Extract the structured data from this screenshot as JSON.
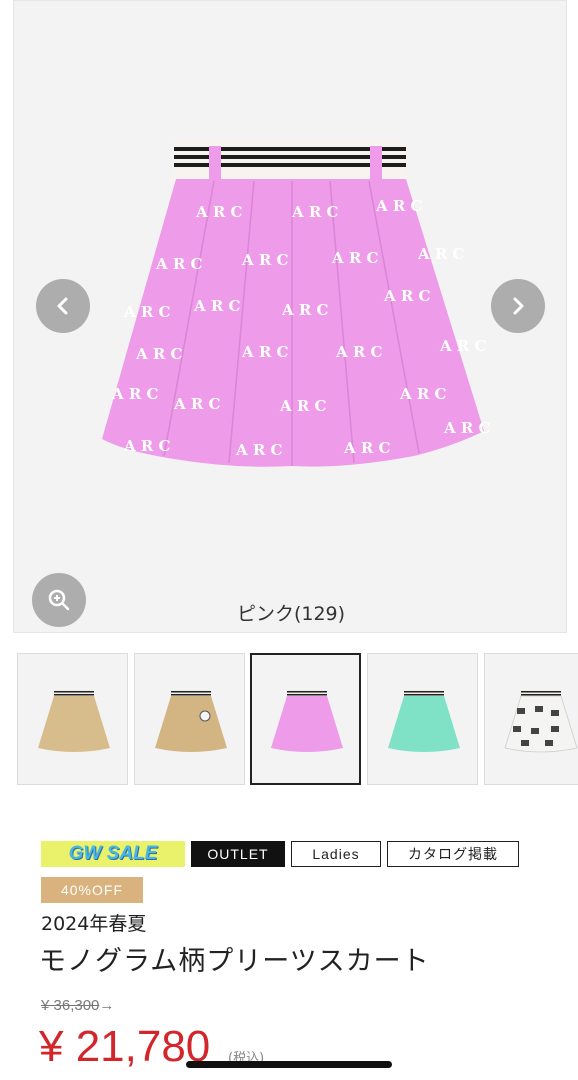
{
  "gallery": {
    "current_color_caption": "ピンク(129)",
    "prev_icon": "chevron-left-icon",
    "next_icon": "chevron-right-icon",
    "zoom_icon": "zoom-in-icon",
    "monogram_text": "ARC",
    "colors": {
      "skirt_pink": "#ee9bea",
      "waistband_white": "#f7f4f0",
      "stripe_black": "#1e1e1e",
      "nav_button": "#969696"
    }
  },
  "thumbnails": [
    {
      "name": "beige",
      "color": "#d7bd8c",
      "active": false
    },
    {
      "name": "beige-patch",
      "color": "#d2b582",
      "active": false
    },
    {
      "name": "pink",
      "color": "#ee9bea",
      "active": true
    },
    {
      "name": "mint",
      "color": "#7fe1c6",
      "active": false
    },
    {
      "name": "white-monogram",
      "color": "#f4f4f2",
      "active": false
    }
  ],
  "badges": {
    "gw_sale": "GW SALE",
    "outlet": "OUTLET",
    "ladies": "Ladies",
    "catalog": "カタログ掲載",
    "discount": "40%OFF",
    "gw_colors": {
      "bg": "#e9f26a",
      "text": "#4bb7e0"
    },
    "discount_color": "#d9b27e"
  },
  "product": {
    "season": "2024年春夏",
    "name": "モノグラム柄プリーツスカート",
    "original_price": "¥ 36,300",
    "arrow": "→",
    "sale_price": "¥ 21,780",
    "tax_note": "(税込)",
    "price_color": "#d3262b"
  }
}
